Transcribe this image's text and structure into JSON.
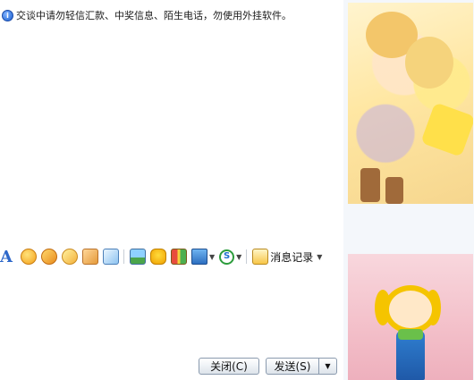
{
  "notice": {
    "text": "交谈中请勿轻信汇款、中奖信息、陌生电话，勿使用外挂软件。",
    "icon": "info-icon"
  },
  "toolbar": {
    "font_label": "A",
    "items": [
      {
        "name": "emoji-icon"
      },
      {
        "name": "magic-face-icon"
      },
      {
        "name": "wink-icon"
      },
      {
        "name": "thumbs-icon"
      },
      {
        "name": "handwrite-icon"
      },
      {
        "name": "image-icon"
      },
      {
        "name": "duck-icon"
      },
      {
        "name": "gift-icon"
      },
      {
        "name": "screenshot-icon"
      },
      {
        "name": "s-icon"
      }
    ],
    "msg_log_label": "消息记录"
  },
  "buttons": {
    "close_label": "关闭(C)",
    "send_label": "发送(S)"
  }
}
